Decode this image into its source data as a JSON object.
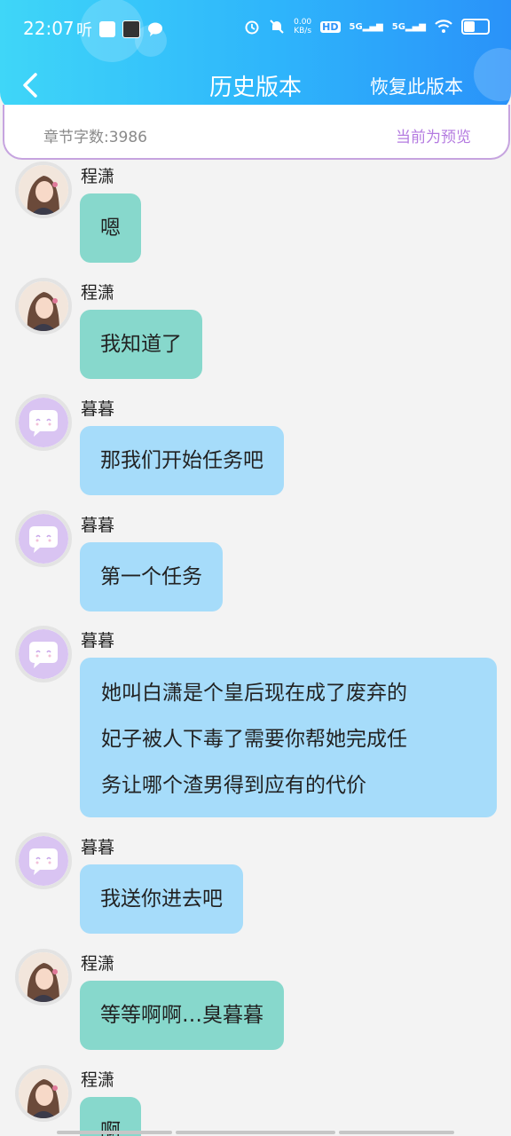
{
  "status_bar": {
    "time": "22:07",
    "listen_label": "听",
    "net_speed": "0.00\nKB/s",
    "net_speed_top": "0.00",
    "net_speed_bottom": "KB/s",
    "hd_label": "HD",
    "sim1": "5G",
    "sim2": "5G"
  },
  "nav": {
    "title": "历史版本",
    "restore_label": "恢复此版本"
  },
  "info": {
    "word_count": "章节字数:3986",
    "preview_label": "当前为预览"
  },
  "colors": {
    "header_start": "#3fd6f8",
    "header_end": "#2a92f9",
    "user_bubble": "#87d8cc",
    "bot_bubble": "#a6dcfa",
    "accent_purple": "#b47be0"
  },
  "messages": [
    {
      "sender": "程潇",
      "text": "嗯",
      "type": "user"
    },
    {
      "sender": "程潇",
      "text": "我知道了",
      "type": "user"
    },
    {
      "sender": "暮暮",
      "text": "那我们开始任务吧",
      "type": "bot"
    },
    {
      "sender": "暮暮",
      "text": "第一个任务",
      "type": "bot"
    },
    {
      "sender": "暮暮",
      "lines": [
        "她叫白潇是个皇后现在成了废弃的",
        "妃子被人下毒了需要你帮她完成任",
        "务让哪个渣男得到应有的代价"
      ],
      "type": "bot"
    },
    {
      "sender": "暮暮",
      "text": "我送你进去吧",
      "type": "bot"
    },
    {
      "sender": "程潇",
      "text": "等等啊啊…臭暮暮",
      "type": "user"
    },
    {
      "sender": "程潇",
      "text": "啊",
      "type": "user"
    }
  ]
}
